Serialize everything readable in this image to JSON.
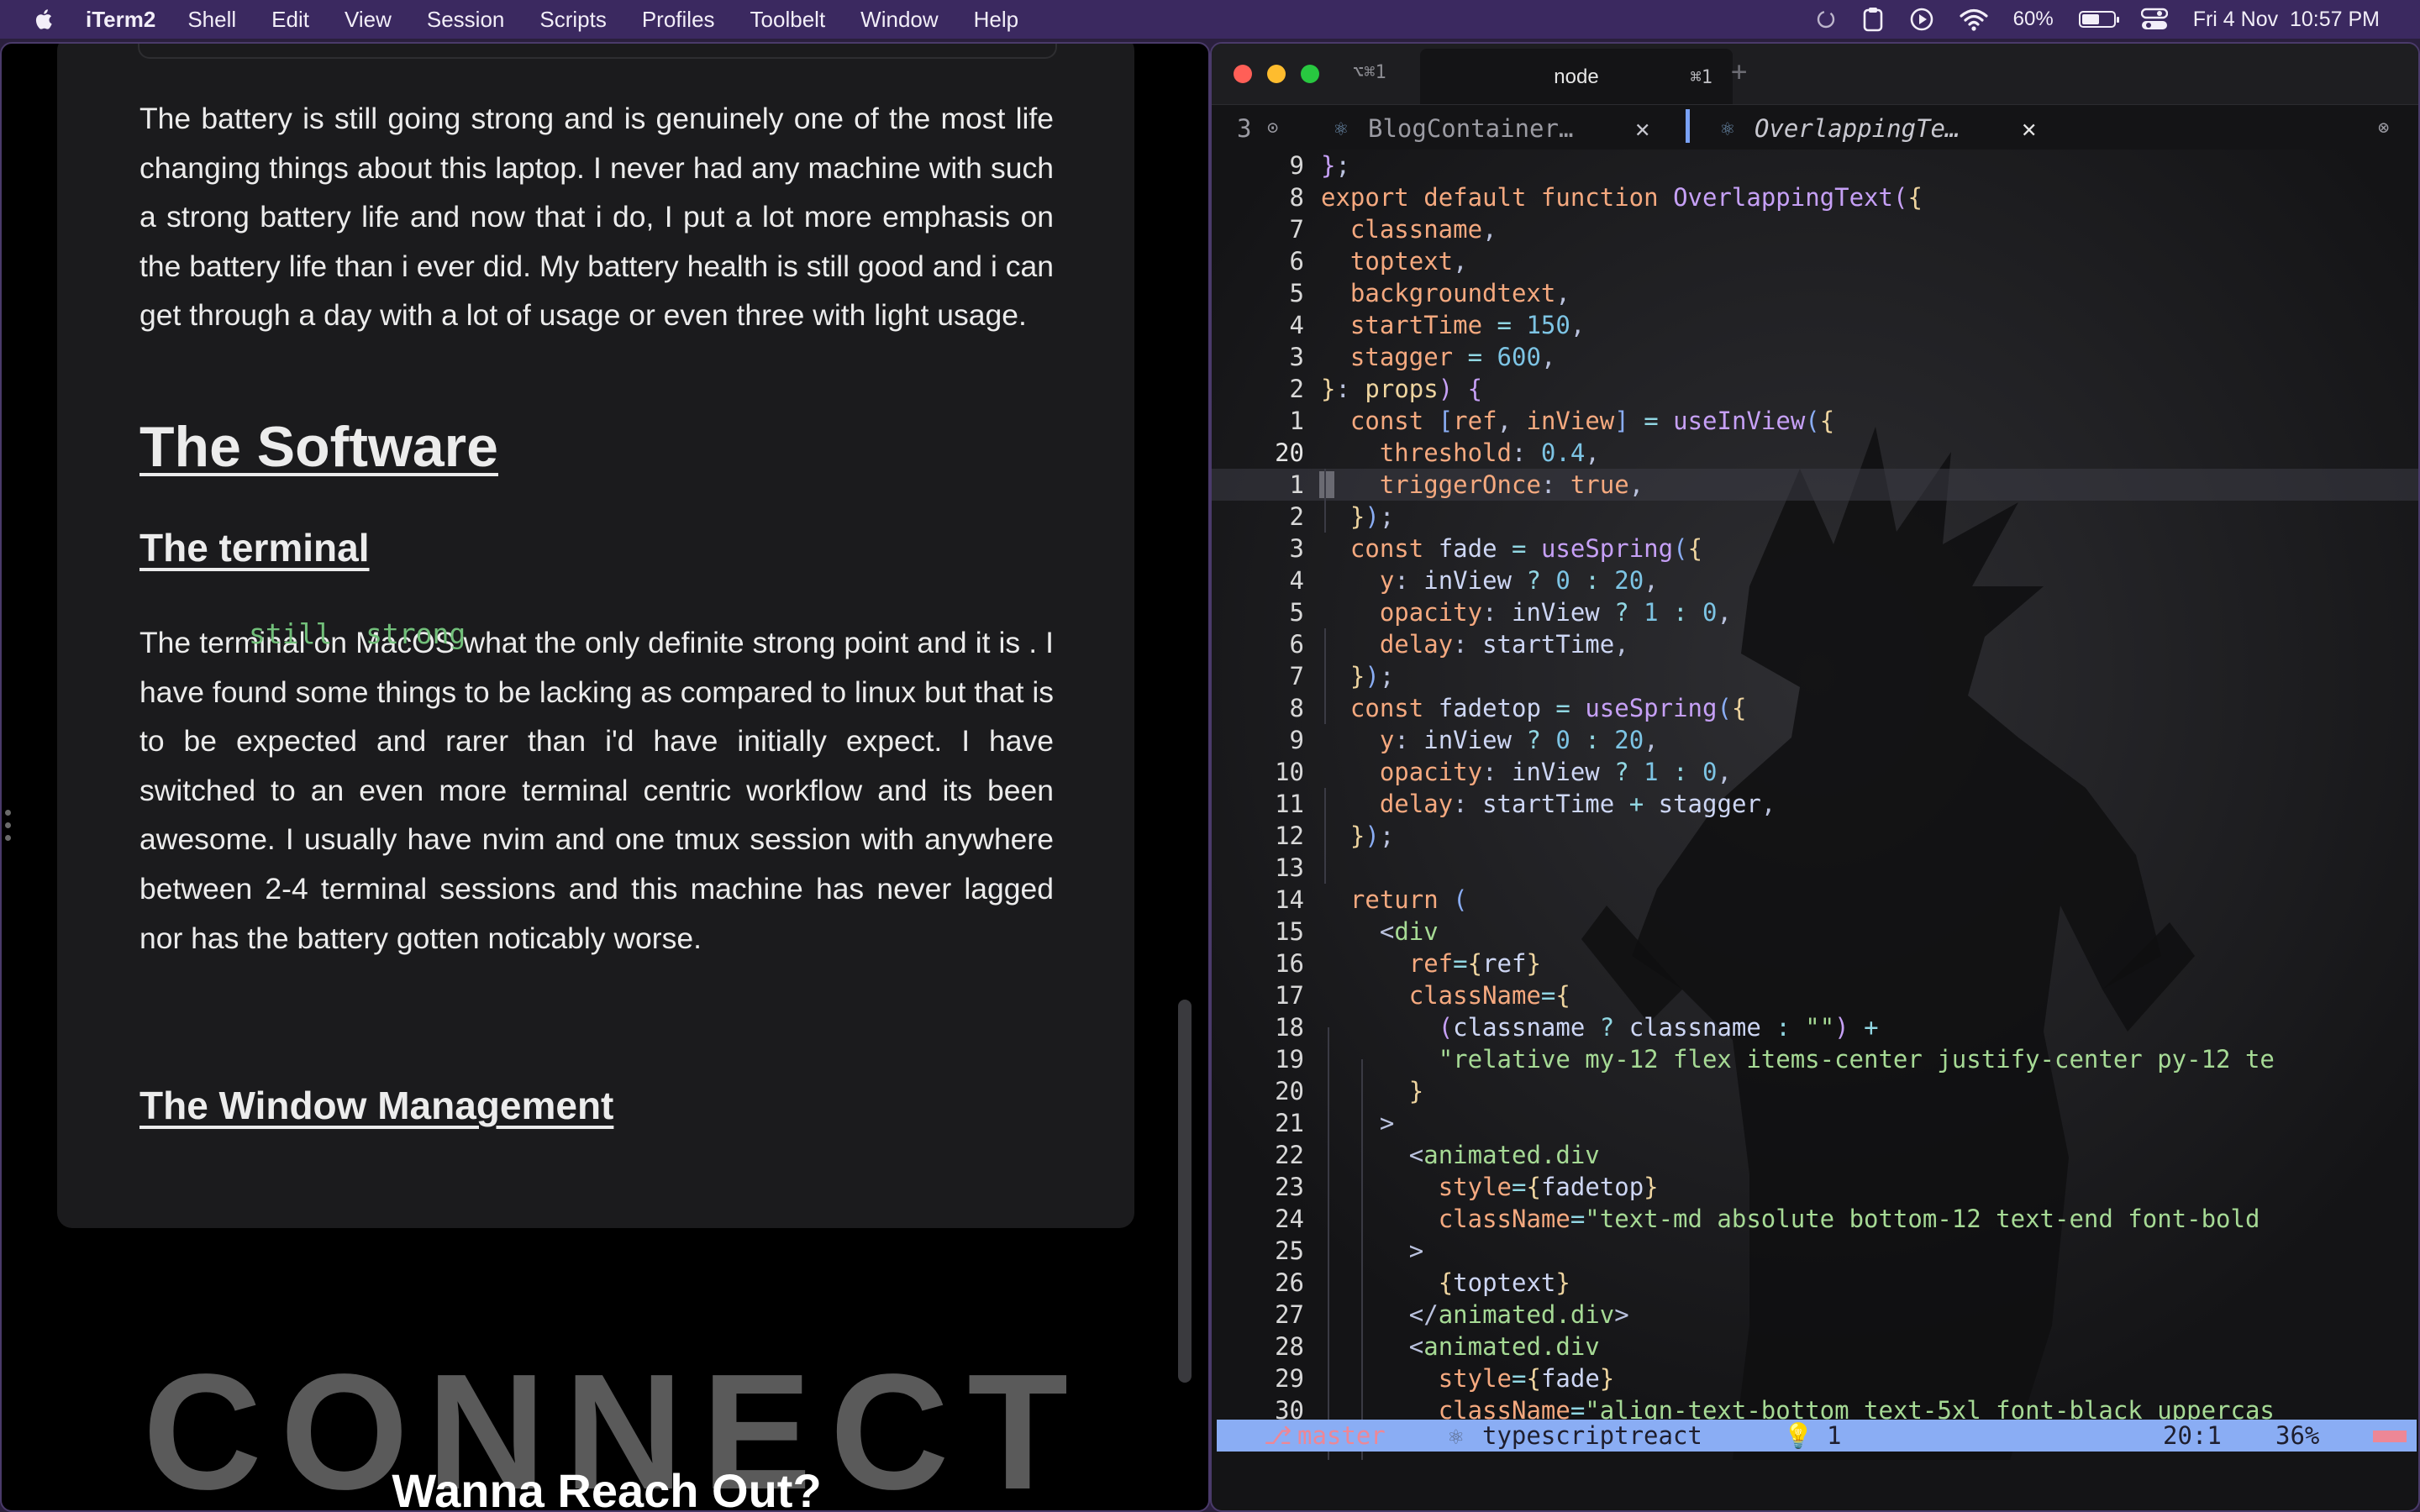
{
  "menubar": {
    "app_name": "iTerm2",
    "menus": [
      "Shell",
      "Edit",
      "View",
      "Session",
      "Scripts",
      "Profiles",
      "Toolbelt",
      "Window",
      "Help"
    ],
    "battery_percent": "60%",
    "battery_level": 0.6,
    "datetime": "Fri 4 Nov  10:57 PM"
  },
  "left_page": {
    "para_battery": "The battery is still going strong and is genuinely one of the most life changing things about this laptop. I never had any machine with such a strong battery life and now that i do, I put a lot more emphasis on the battery life than i ever did. My battery health is still good and i can get through a day with a lot of usage or even three with light usage.",
    "heading_software": "The Software",
    "heading_terminal": "The terminal",
    "para_terminal_a": "The terminal on MacOS what the only definite strong point and it is ",
    "para_terminal_code": "still  strong",
    "para_terminal_b": ". I have found some things to be lacking as compared to linux but that is to be expected and rarer than i'd have initially expect. I have switched to an even more terminal centric workflow and its been awesome. I usually have nvim and one tmux session with anywhere between 2-4 terminal sessions and this machine has never lagged nor has the battery gotten noticably worse.",
    "heading_wm": "The Window Management",
    "connect_bg": "CONNECT",
    "reach_out": "Wanna Reach Out?"
  },
  "terminal": {
    "tab_short_label": "⌥⌘1",
    "tab_title": "node",
    "tab_shortcut": "⌘1",
    "buffer_count": "3",
    "buffers": [
      "BlogContainer…",
      "OverlappingTe…"
    ],
    "line_numbers": [
      "9",
      "8",
      "7",
      "6",
      "5",
      "4",
      "3",
      "2",
      "1",
      "20",
      "1",
      "2",
      "3",
      "4",
      "5",
      "6",
      "7",
      "8",
      "9",
      "10",
      "11",
      "12",
      "13",
      "14",
      "15",
      "16",
      "17",
      "18",
      "19",
      "20",
      "21",
      "22",
      "23",
      "24",
      "25",
      "26",
      "27",
      "28",
      "29",
      "30"
    ],
    "status": {
      "branch": "master",
      "filetype": "typescriptreact",
      "diagnostics": "1",
      "position": "20:1",
      "percent": "36%"
    },
    "colors": {
      "status_bg": "#8aadf4",
      "accent": "#7aa2f7"
    }
  }
}
